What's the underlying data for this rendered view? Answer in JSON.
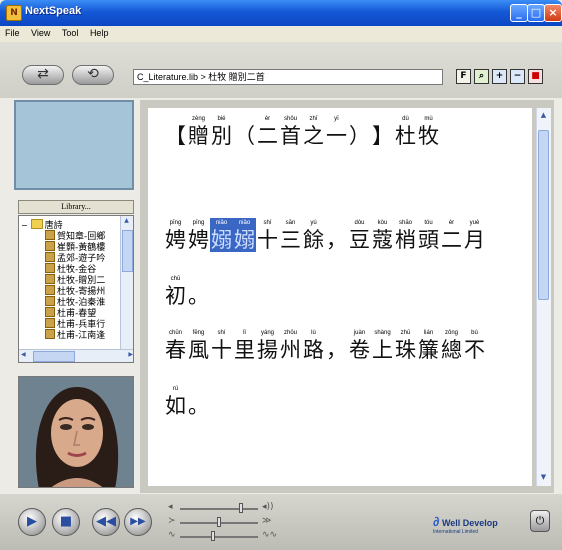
{
  "window": {
    "title": "NextSpeak"
  },
  "menu": [
    "File",
    "View",
    "Tool",
    "Help"
  ],
  "toolbar": {
    "path": "C_Literature.lib > 杜牧 贈別二首"
  },
  "library_button": "Library...",
  "tree": {
    "root": "唐詩",
    "items": [
      "賀知章-回鄉",
      "崔顥-黃鶴樓",
      "孟郊-遊子吟",
      "杜牧-金谷",
      "杜牧-贈別二",
      "杜牧-寄揚州",
      "杜牧-泊秦淮",
      "杜甫-春望",
      "杜甫-兵車行",
      "杜甫-江南逢"
    ]
  },
  "content": {
    "title_line": [
      {
        "py": "",
        "hz": "【"
      },
      {
        "py": "zèng",
        "hz": "贈"
      },
      {
        "py": "bié",
        "hz": "別"
      },
      {
        "py": "",
        "hz": "（"
      },
      {
        "py": "èr",
        "hz": "二"
      },
      {
        "py": "shǒu",
        "hz": "首"
      },
      {
        "py": "zhī",
        "hz": "之"
      },
      {
        "py": "yī",
        "hz": "一"
      },
      {
        "py": "",
        "hz": "）"
      },
      {
        "py": "",
        "hz": "】"
      },
      {
        "py": "dù",
        "hz": "杜"
      },
      {
        "py": "mù",
        "hz": "牧"
      }
    ],
    "line1": [
      {
        "py": "pīng",
        "hz": "娉"
      },
      {
        "py": "pīng",
        "hz": "娉"
      },
      {
        "py": "niǎo",
        "hz": "嫋",
        "hl": true
      },
      {
        "py": "niǎo",
        "hz": "嫋",
        "hl": true
      },
      {
        "py": "shí",
        "hz": "十"
      },
      {
        "py": "sān",
        "hz": "三"
      },
      {
        "py": "yú",
        "hz": "餘"
      },
      {
        "py": "",
        "hz": "，"
      },
      {
        "py": "dòu",
        "hz": "豆"
      },
      {
        "py": "kòu",
        "hz": "蔻"
      },
      {
        "py": "shāo",
        "hz": "梢"
      },
      {
        "py": "tóu",
        "hz": "頭"
      },
      {
        "py": "èr",
        "hz": "二"
      },
      {
        "py": "yuè",
        "hz": "月"
      }
    ],
    "line1b": [
      {
        "py": "chū",
        "hz": "初"
      },
      {
        "py": "",
        "hz": "。"
      }
    ],
    "line2": [
      {
        "py": "chūn",
        "hz": "春"
      },
      {
        "py": "fēng",
        "hz": "風"
      },
      {
        "py": "shí",
        "hz": "十"
      },
      {
        "py": "lǐ",
        "hz": "里"
      },
      {
        "py": "yáng",
        "hz": "揚"
      },
      {
        "py": "zhōu",
        "hz": "州"
      },
      {
        "py": "lù",
        "hz": "路"
      },
      {
        "py": "",
        "hz": "，"
      },
      {
        "py": "juàn",
        "hz": "卷"
      },
      {
        "py": "shàng",
        "hz": "上"
      },
      {
        "py": "zhū",
        "hz": "珠"
      },
      {
        "py": "lián",
        "hz": "簾"
      },
      {
        "py": "zǒng",
        "hz": "總"
      },
      {
        "py": "bú",
        "hz": "不"
      }
    ],
    "line2b": [
      {
        "py": "rú",
        "hz": "如"
      },
      {
        "py": "",
        "hz": "。"
      }
    ]
  },
  "controls": {
    "volume": 0.78,
    "speed": 0.5,
    "pitch": 0.42
  },
  "logo": {
    "name": "Well Develop",
    "sub": "International Limited"
  }
}
